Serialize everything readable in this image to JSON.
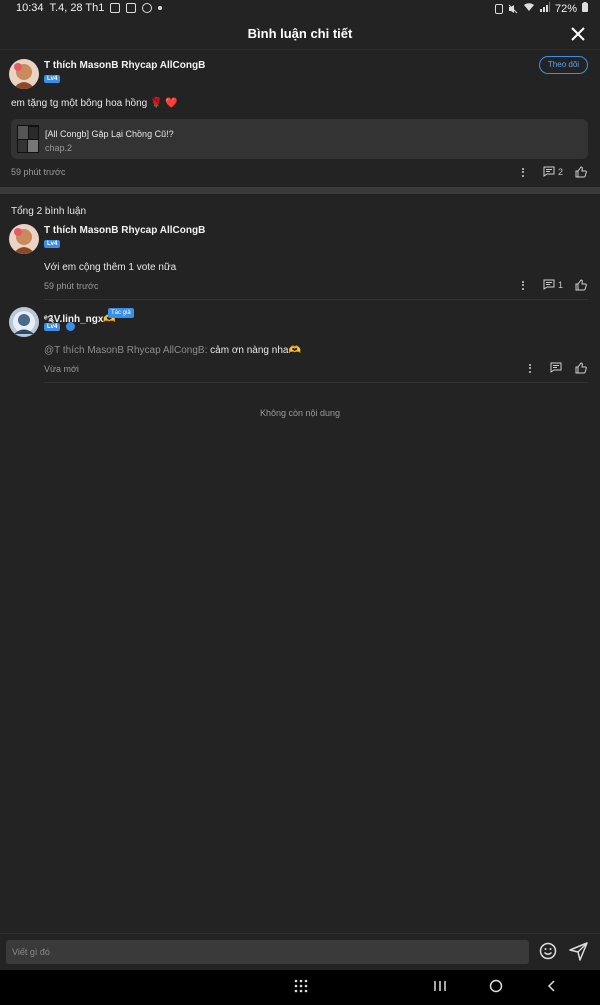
{
  "status_bar": {
    "time": "10:34",
    "date": "T.4, 28 Th1",
    "battery": "72%"
  },
  "header": {
    "title": "Bình luận chi tiết"
  },
  "main_comment": {
    "username": "T thích MasonB Rhycap AllCongB",
    "level": "Lv4",
    "follow_label": "Theo dõi",
    "text": "em tặng tg một bông hoa hồng 🌹 ❤️",
    "story": {
      "title": "[All Congb] Gặp Lại Chồng Cũ!?",
      "chapter": "chap.2"
    },
    "time": "59 phút trước",
    "reply_count": "2"
  },
  "replies_total": "Tổng 2 bình luận",
  "replies": [
    {
      "username": "T thích MasonB Rhycap AllCongB",
      "level": "Lv4",
      "text": "Với em cộng thêm 1 vote nữa",
      "time": "59 phút trước",
      "reply_count": "1"
    },
    {
      "username": "ᵉ༉V.linh_ngx🫶",
      "level": "Lv4",
      "author_badge": "Tác giả",
      "mention": "@T thích MasonB Rhycap AllCongB:",
      "text": "cảm ơn nàng nha🫶",
      "time": "Vừa mới"
    }
  ],
  "empty_text": "Không còn nội dung",
  "composer": {
    "placeholder": "Viết gì đó"
  },
  "colors": {
    "background": "#232323",
    "accent": "#3b8fe6"
  }
}
